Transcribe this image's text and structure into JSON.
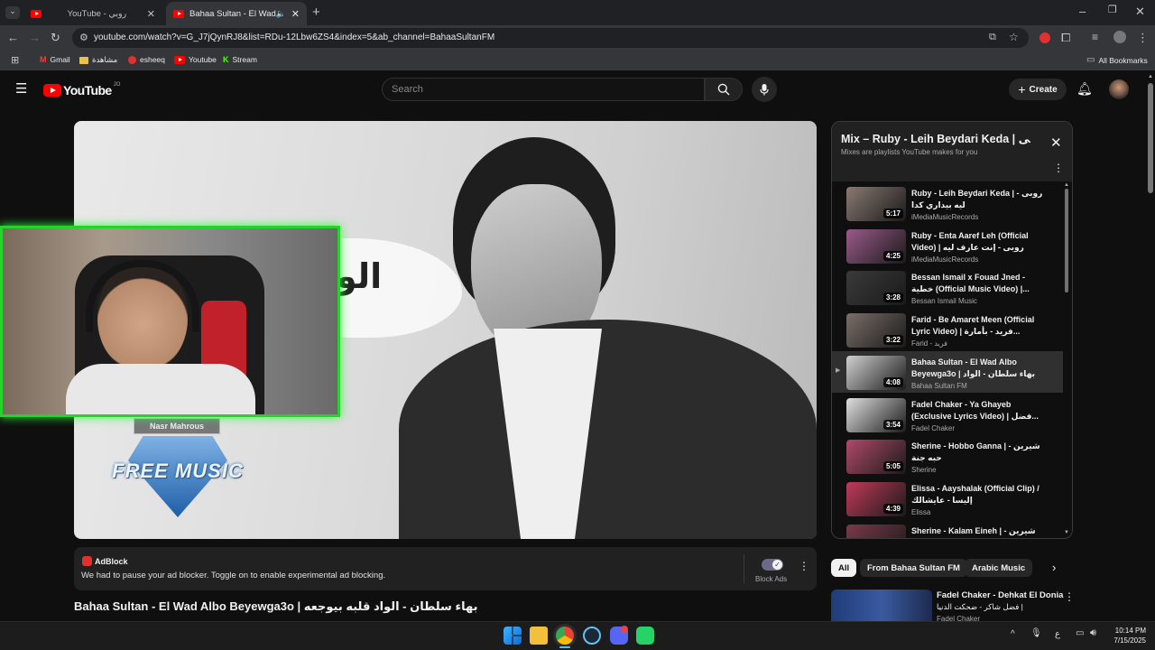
{
  "browser": {
    "tabs": [
      {
        "label": "YouTube - روبي",
        "active": false
      },
      {
        "label": "Bahaa Sultan - El Wad Albo",
        "active": true
      }
    ],
    "url": "youtube.com/watch?v=G_J7jQynRJ8&list=RDu-12Lbw6ZS4&index=5&ab_channel=BahaaSultanFM",
    "bookmarks": [
      "Gmail",
      "مشاهدة",
      "esheeq",
      "Youtube",
      "Stream"
    ],
    "all_bookmarks_label": "All Bookmarks"
  },
  "youtube": {
    "logo_text": "YouTube",
    "country_code": "JO",
    "search_placeholder": "Search",
    "create_label": "Create"
  },
  "player": {
    "overlay_text": "الو",
    "watermark_top": "Nasr Mahrous",
    "watermark_main": "FREE MUSIC"
  },
  "adblock": {
    "brand": "AdBlock",
    "message": "We had to pause your ad blocker. Toggle on to enable experimental ad blocking.",
    "toggle_label": "Block Ads"
  },
  "video": {
    "title": "Bahaa Sultan - El Wad Albo Beyewga3o | بهاء سلطان - الواد قلبه بيوجعه"
  },
  "playlist": {
    "title": "Mix – Ruby - Leih Beydari Keda | روبى",
    "subtitle": "Mixes are playlists YouTube makes for you",
    "items": [
      {
        "title": "Ruby - Leih Beydari Keda | روبى - ليه بيداري كدا",
        "channel": "iMediaMusicRecords",
        "duration": "5:17",
        "color": "#8a7a72",
        "current": false
      },
      {
        "title": "Ruby - Enta Aaref Leh (Official Video) | روبى - إنت عارف ليه",
        "channel": "iMediaMusicRecords",
        "duration": "4:25",
        "color": "#9a5a8a",
        "current": false
      },
      {
        "title": "Bessan Ismail x Fouad Jned - خطية (Official Music Video) |...",
        "channel": "Bessan Ismail Music",
        "duration": "3:28",
        "color": "#3a3a3a",
        "current": false
      },
      {
        "title": "Farid - Be Amaret Meen (Official Lyric Video) | فريد - بأمارة...",
        "channel": "Farid - فريد",
        "duration": "3:22",
        "color": "#7a6e68",
        "current": false
      },
      {
        "title": "Bahaa Sultan - El Wad Albo Beyewga3o | بهاء سلطان - الواد قلبه...",
        "channel": "Bahaa Sultan FM",
        "duration": "4:08",
        "color": "#d0d0d0",
        "current": true
      },
      {
        "title": "Fadel Chaker - Ya Ghayeb (Exclusive Lyrics Video) | فضل...",
        "channel": "Fadel Chaker",
        "duration": "3:54",
        "color": "#e0e0e0",
        "current": false
      },
      {
        "title": "Sherine - Hobbo Ganna | شيرين - حبه جنة",
        "channel": "Sherine",
        "duration": "5:05",
        "color": "#b04a6a",
        "current": false
      },
      {
        "title": "Elissa - Aayshalak (Official Clip) / إليسا - عايشالك",
        "channel": "Elissa",
        "duration": "4:39",
        "color": "#c03a5a",
        "current": false
      },
      {
        "title": "Sherine - Kalam Eineh | شيرين - كلام عينيه",
        "channel": "",
        "duration": "",
        "color": "#7a3a4a",
        "current": false
      }
    ]
  },
  "chips": [
    "All",
    "From Bahaa Sultan FM",
    "Arabic Music"
  ],
  "recommended": {
    "title": "Fadel Chaker - Dehkat El Donia",
    "subtitle": "فضل شاكر - ضحكت الدنيا |",
    "channel": "Fadel Chaker"
  },
  "taskbar": {
    "language": "ع",
    "time": "10:14 PM",
    "date": "7/15/2025"
  }
}
